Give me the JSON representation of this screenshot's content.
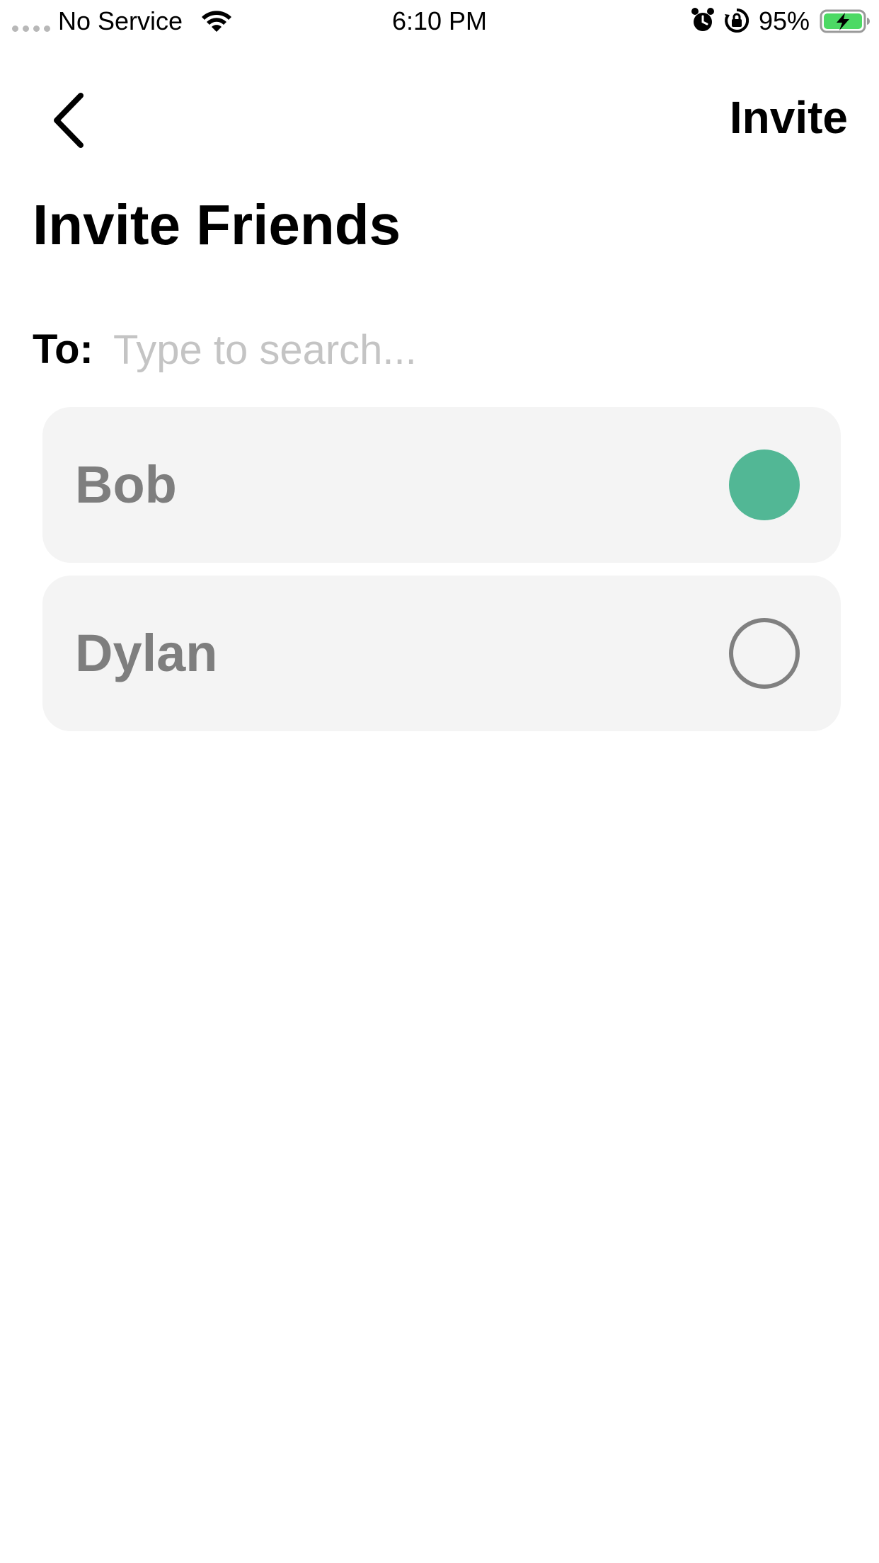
{
  "status_bar": {
    "carrier": "No Service",
    "time": "6:10 PM",
    "battery_percent": "95%",
    "icons": [
      "signal-dots-icon",
      "wifi-icon",
      "alarm-icon",
      "rotation-lock-icon",
      "battery-charging-icon"
    ],
    "battery_level": 0.95,
    "battery_color": "#4cd964"
  },
  "nav": {
    "back_icon": "chevron-left-icon",
    "invite_label": "Invite"
  },
  "title": "Invite Friends",
  "search": {
    "label": "To:",
    "value": "",
    "placeholder": "Type to search..."
  },
  "friends": [
    {
      "name": "Bob",
      "selected": true
    },
    {
      "name": "Dylan",
      "selected": false
    }
  ],
  "colors": {
    "selected_accent": "#52b795",
    "row_background": "#f4f4f4",
    "name_text": "#7e7e7e",
    "placeholder_text": "#c4c4c4"
  }
}
